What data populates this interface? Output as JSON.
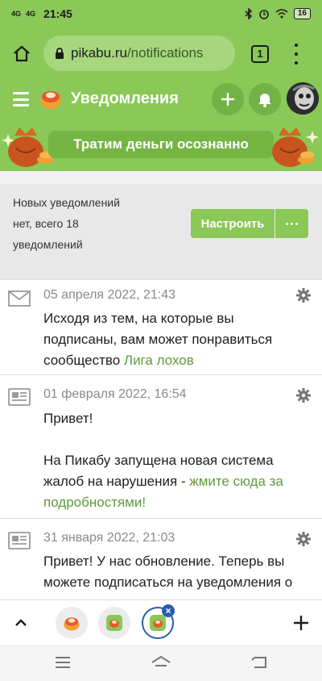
{
  "status_bar": {
    "net1": "4G",
    "net2": "4G",
    "time": "21:45",
    "battery": "16"
  },
  "browser": {
    "url_domain": "pikabu.ru",
    "url_path": "/notifications",
    "tab_count": "1"
  },
  "header": {
    "title": "Уведомления"
  },
  "banner": {
    "text": "Тратим деньги осознанно"
  },
  "info": {
    "text": "Новых уведомлений нет, всего 18 уведомлений",
    "setup_label": "Настроить"
  },
  "notifications": [
    {
      "date": "05 апреля 2022, 21:43",
      "text": "Исходя из тем, на которые вы подписаны, вам может понравиться сообщество ",
      "link": "Лига лохов",
      "icon": "envelope-icon"
    },
    {
      "date": "01 февраля 2022, 16:54",
      "line1": "Привет!",
      "text": "На Пикабу запущена новая система жалоб на нарушения - ",
      "link": "жмите сюда за подробностями!",
      "icon": "newspaper-icon"
    },
    {
      "date": "31 января 2022, 21:03",
      "text": "Привет! У нас обновление. Теперь вы можете подписаться на уведомления о",
      "icon": "newspaper-icon"
    }
  ],
  "colors": {
    "brand_green": "#8ac858",
    "link_green": "#5f9a3a",
    "active_tab_blue": "#2a5db0"
  }
}
